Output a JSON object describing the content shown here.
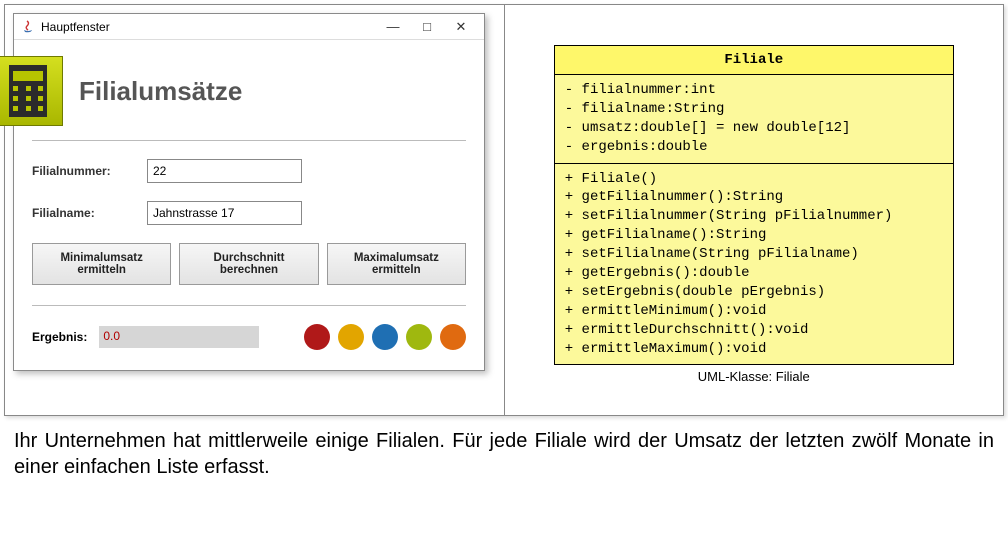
{
  "window": {
    "title": "Hauptfenster",
    "appTitle": "Filialumsätze",
    "labels": {
      "filialnummer": "Filialnummer:",
      "filialname": "Filialname:",
      "ergebnis": "Ergebnis:"
    },
    "fields": {
      "filialnummer": "22",
      "filialname": "Jahnstrasse 17"
    },
    "buttons": {
      "min": "Minimalumsatz ermitteln",
      "avg": "Durchschnitt berechnen",
      "max": "Maximalumsatz ermitteln"
    },
    "result": "0.0",
    "dotColors": [
      "#b01919",
      "#e2a500",
      "#1f6fb3",
      "#9fb80f",
      "#e06a10"
    ]
  },
  "uml": {
    "className": "Filiale",
    "attributes": [
      "- filialnummer:int",
      "- filialname:String",
      "- umsatz:double[] = new double[12]",
      "- ergebnis:double"
    ],
    "methods": [
      "+ Filiale()",
      "+ getFilialnummer():String",
      "+ setFilialnummer(String pFilialnummer)",
      "+ getFilialname():String",
      "+ setFilialname(String pFilialname)",
      "+ getErgebnis():double",
      "+ setErgebnis(double pErgebnis)",
      "+ ermittleMinimum():void",
      "+ ermittleDurchschnitt():void",
      "+ ermittleMaximum():void"
    ],
    "caption": "UML-Klasse: Filiale"
  },
  "bodyText": "Ihr Unternehmen hat mittlerweile einige Filialen. Für jede Filiale wird der Umsatz der letzten zwölf Monate in einer einfachen Liste erfasst."
}
